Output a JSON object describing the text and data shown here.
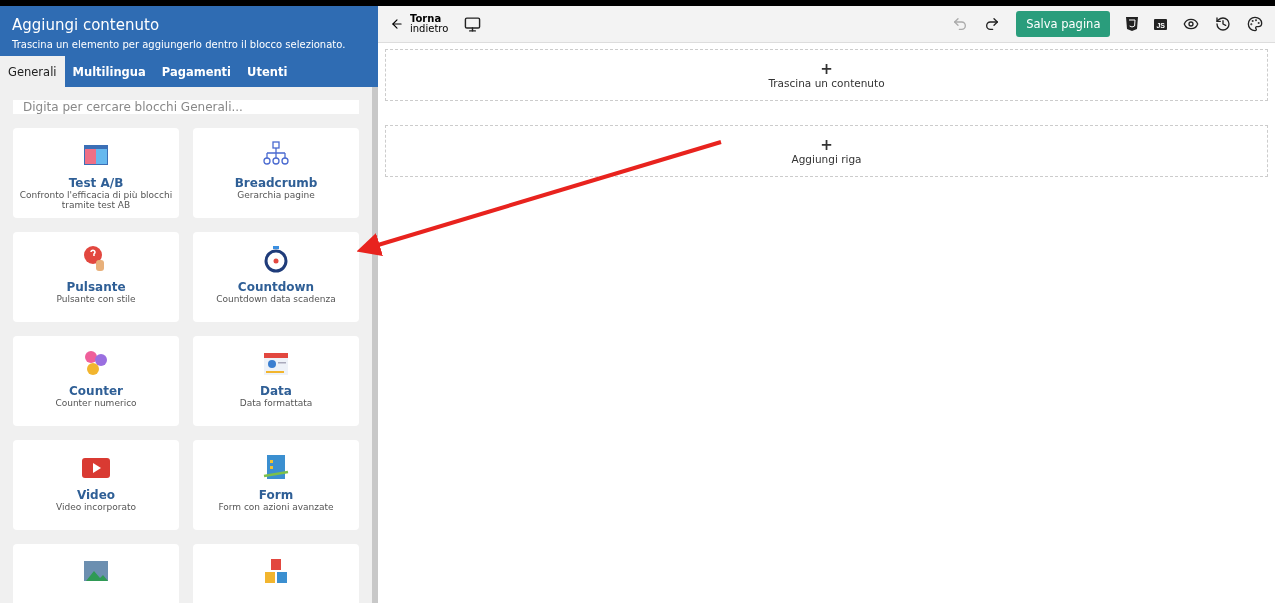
{
  "sidebar": {
    "title": "Aggiungi contenuto",
    "subtitle": "Trascina un elemento per aggiungerlo dentro il blocco selezionato.",
    "tabs": [
      {
        "label": "Generali",
        "selected": true
      },
      {
        "label": "Multilingua",
        "selected": false
      },
      {
        "label": "Pagamenti",
        "selected": false
      },
      {
        "label": "Utenti",
        "selected": false
      }
    ],
    "search": {
      "placeholder": "Digita per cercare blocchi Generali..."
    },
    "blocks": [
      {
        "kind": "ab",
        "title": "Test A/B",
        "description": "Confronto l'efficacia di più blocchi tramite test AB"
      },
      {
        "kind": "tree",
        "title": "Breadcrumb",
        "description": "Gerarchia pagine"
      },
      {
        "kind": "help",
        "title": "Pulsante",
        "description": "Pulsante con stile"
      },
      {
        "kind": "stopwatch",
        "title": "Countdown",
        "description": "Countdown data scadenza"
      },
      {
        "kind": "counter",
        "title": "Counter",
        "description": "Counter numerico"
      },
      {
        "kind": "calendar",
        "title": "Data",
        "description": "Data formattata"
      },
      {
        "kind": "video",
        "title": "Video",
        "description": "Video incorporato"
      },
      {
        "kind": "form",
        "title": "Form",
        "description": "Form con azioni avanzate"
      },
      {
        "kind": "image"
      },
      {
        "kind": "blocks"
      }
    ]
  },
  "toolbar": {
    "back": {
      "title": "Torna",
      "subtitle": "indietro"
    },
    "save_label": "Salva pagina",
    "js_label": "JS"
  },
  "canvas": {
    "drop_zones": [
      {
        "symbol": "+",
        "label": "Trascina un contenuto"
      },
      {
        "symbol": "+",
        "label": "Aggiungi riga"
      }
    ]
  }
}
